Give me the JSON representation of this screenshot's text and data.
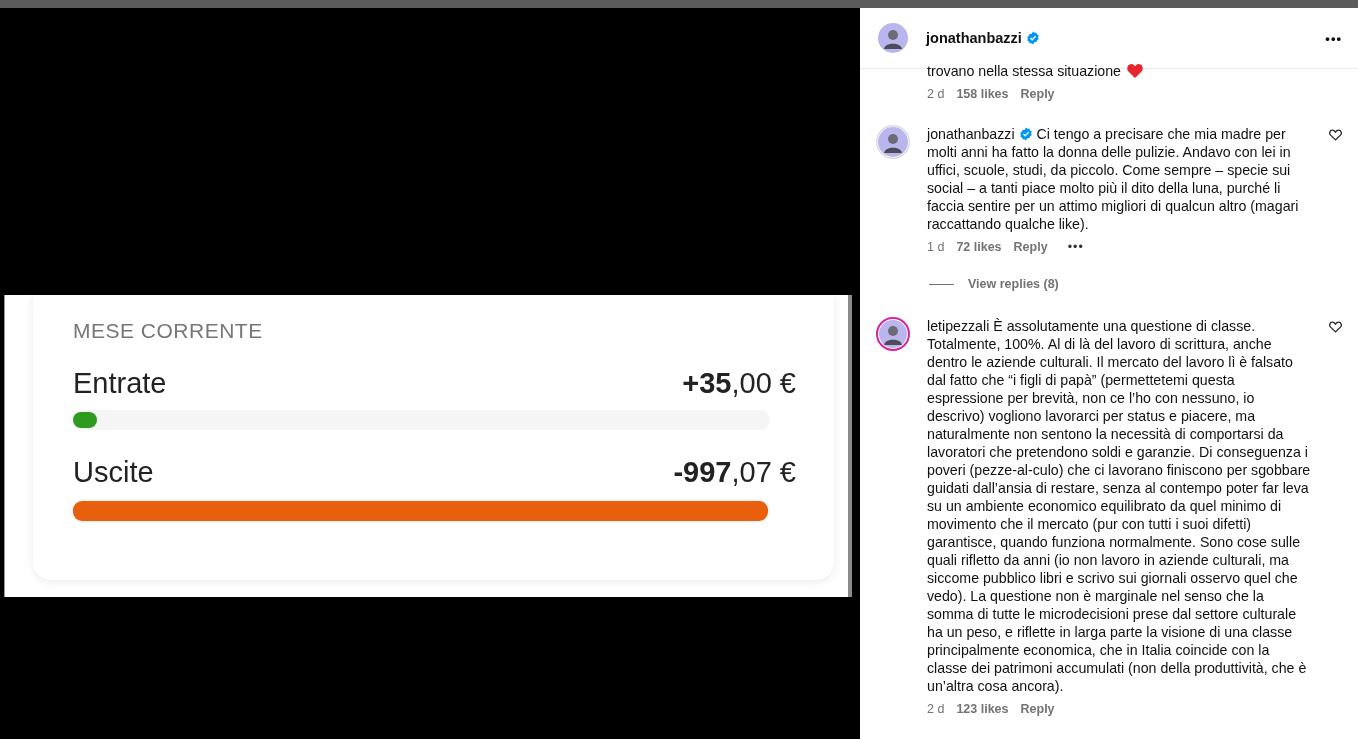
{
  "post_image": {
    "section_title": "MESE CORRENTE",
    "rows": [
      {
        "label": "Entrate",
        "amount": "**+35**,00 €",
        "level": 0.035,
        "color": "#2f9a1f"
      },
      {
        "label": "Uscite",
        "amount": "**-997**,07 €",
        "level": 1,
        "color": "#e8600e"
      }
    ]
  },
  "header": {
    "username": "jonathanbazzi",
    "verified": true,
    "more": "•••"
  },
  "comments": [
    {
      "kind": "tail",
      "text": "trovano nella stessa situazione",
      "time": "2 d",
      "likes": "158 likes",
      "reply": "Reply"
    },
    {
      "kind": "comment",
      "username": "jonathanbazzi",
      "verified": true,
      "story_ring": false,
      "text": "Ci tengo a precisare che mia madre per molti anni ha fatto la donna delle pulizie. Andavo con lei in uffici, scuole, studi, da piccolo. Come sempre – specie sui social – a tanti piace molto più il dito della luna, purché li faccia sentire per un attimo migliori di qualcun altro (magari raccattando qualche like).",
      "time": "1 d",
      "likes": "72 likes",
      "reply": "Reply",
      "more": "•••",
      "view_replies": "View replies (8)"
    },
    {
      "kind": "comment",
      "username": "letipezzali",
      "verified": false,
      "story_ring": true,
      "text": "È assolutamente una questione di classe. Totalmente, 100%. Al di là del lavoro di scrittura, anche dentro le aziende culturali. Il mercato del lavoro lì è falsato dal fatto che “i figli di papà” (permettetemi questa espressione per brevità, non ce l’ho con nessuno, io descrivo) vogliono lavorarci per status e piacere, ma naturalmente non sentono la necessità di comportarsi da lavoratori che pretendono soldi e garanzie. Di conseguenza i poveri (pezze-al-culo) che ci lavorano finiscono per sgobbare guidati dall’ansia di restare, senza al contempo poter far leva su un ambiente economico equilibrato da quel minimo di movimento che il mercato (pur con tutti i suoi difetti) garantisce, quando funziona normalmente. Sono cose sulle quali rifletto da anni (io non lavoro in aziende culturali, ma siccome pubblico libri e scrivo sui giornali osservo quel che vedo). La questione non è marginale nel senso che la somma di tutte le microdecisioni prese dal settore culturale ha un peso, e riflette in larga parte la visione di una classe principalmente economica, che in Italia coincide con la classe dei patrimoni accumulati (non della produttività, che è un’altra cosa ancora).",
      "time": "2 d",
      "likes": "123 likes",
      "reply": "Reply"
    }
  ]
}
